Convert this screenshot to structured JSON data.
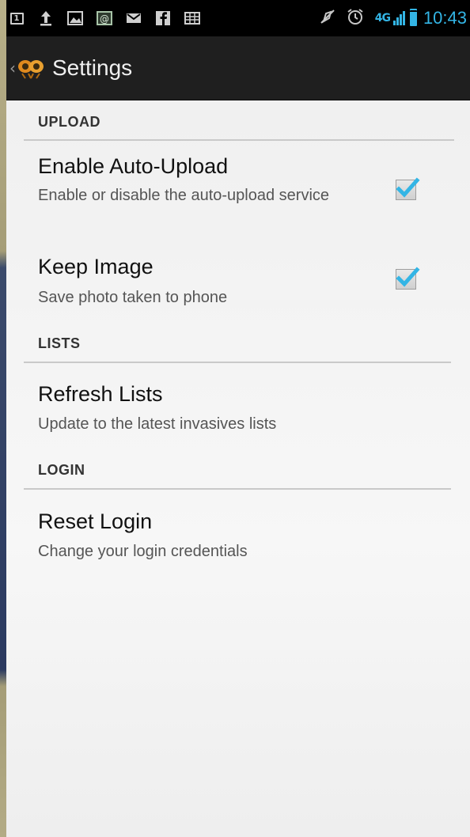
{
  "status_bar": {
    "icons": [
      "calendar-icon",
      "upload-icon",
      "gallery-icon",
      "email-icon",
      "mail-icon",
      "facebook-icon",
      "keyboard-icon",
      "mute-icon",
      "alarm-icon"
    ],
    "calendar_day": "1",
    "network": "4G",
    "time": "10:43"
  },
  "action_bar": {
    "title": "Settings"
  },
  "sections": {
    "upload": {
      "header": "UPLOAD",
      "auto_upload": {
        "title": "Enable Auto-Upload",
        "summary": "Enable or disable the auto-upload service",
        "checked": true
      },
      "keep_image": {
        "title": "Keep Image",
        "summary": "Save photo taken to phone",
        "checked": true
      }
    },
    "lists": {
      "header": "LISTS",
      "refresh": {
        "title": "Refresh Lists",
        "summary": "Update to the latest invasives lists"
      }
    },
    "login": {
      "header": "LOGIN",
      "reset": {
        "title": "Reset Login",
        "summary": "Change your login credentials"
      }
    }
  },
  "colors": {
    "accent": "#33b5e5",
    "action_bar": "#1f1f1f",
    "status_bar": "#000000",
    "background": "#f2f2f2"
  }
}
